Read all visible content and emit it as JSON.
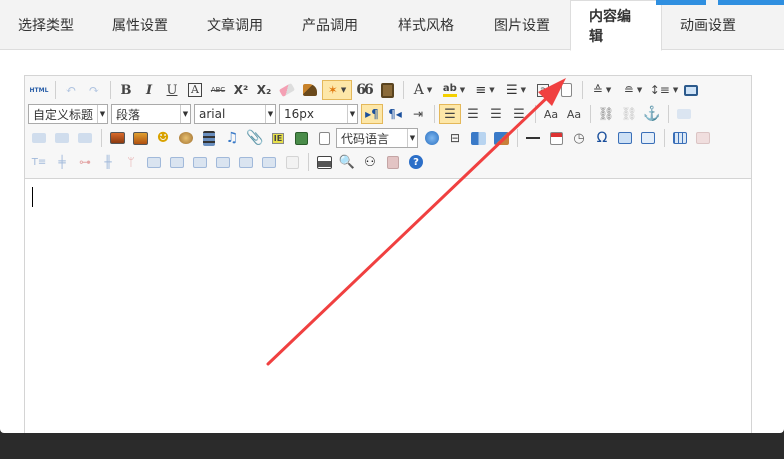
{
  "tabs": [
    {
      "label": "选择类型",
      "active": false
    },
    {
      "label": "属性设置",
      "active": false
    },
    {
      "label": "文章调用",
      "active": false
    },
    {
      "label": "产品调用",
      "active": false
    },
    {
      "label": "样式风格",
      "active": false
    },
    {
      "label": "图片设置",
      "active": false
    },
    {
      "label": "内容编辑",
      "active": true
    },
    {
      "label": "动画设置",
      "active": false
    }
  ],
  "toolbar": {
    "html_label": "HTML",
    "bold": "B",
    "italic": "I",
    "underline": "U",
    "strike": "ABC",
    "superscript": "X²",
    "subscript": "X₂",
    "quote": "66",
    "font_color": "A",
    "custom_heading": "自定义标题",
    "paragraph": "段落",
    "font_family": "arial",
    "font_size": "16px",
    "code_language": "代码语言",
    "special_char": "Ω"
  },
  "colors": {
    "accent_blue": "#2f8fe0",
    "arrow_red": "#f04040",
    "active_highlight": "#fde7a8"
  }
}
